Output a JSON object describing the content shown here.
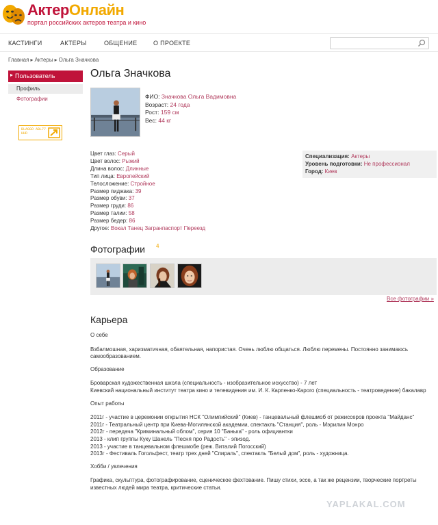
{
  "brand": {
    "title_part1": "Актер",
    "title_part2": "Онлайн",
    "subtitle": "портал российских актеров театра и кино"
  },
  "nav": {
    "items": [
      "КАСТИНГИ",
      "АКТЕРЫ",
      "ОБЩЕНИЕ",
      "О ПРОЕКТЕ"
    ]
  },
  "search": {
    "placeholder": "",
    "value": ""
  },
  "breadcrumb": [
    "Главная",
    "Актеры",
    "Ольга Значкова"
  ],
  "sidebar": {
    "header": "Пользователь",
    "items": [
      "Профиль",
      "Фотографии"
    ],
    "banner_text": "BLAGGO ABL77 HHD"
  },
  "profile": {
    "name": "Ольга Значкова",
    "fio_label": "ФИО:",
    "fio": "Значкова Ольга Вадимовна",
    "age_label": "Возраст:",
    "age": "24 года",
    "height_label": "Рост:",
    "height": "159 см",
    "weight_label": "Вес:",
    "weight": "44 кг"
  },
  "attributes": [
    {
      "label": "Цвет глаз:",
      "value": "Серый"
    },
    {
      "label": "Цвет волос:",
      "value": "Рыжий"
    },
    {
      "label": "Длина волос:",
      "value": "Длинные"
    },
    {
      "label": "Тип лица:",
      "value": "Европейский"
    },
    {
      "label": "Телосложение:",
      "value": "Стройное"
    },
    {
      "label": "Размер пиджака:",
      "value": "39"
    },
    {
      "label": "Размер обуви:",
      "value": "37"
    },
    {
      "label": "Размер груди:",
      "value": "86"
    },
    {
      "label": "Размер талии:",
      "value": "58"
    },
    {
      "label": "Размер бедер:",
      "value": "86"
    },
    {
      "label": "Другое:",
      "value": "Вокал Танец Загранпаспорт Переезд"
    }
  ],
  "info": [
    {
      "label": "Специализация:",
      "value": "Актеры"
    },
    {
      "label": "Уровень подготовки:",
      "value": "Не профессионал"
    },
    {
      "label": "Город:",
      "value": "Киев"
    }
  ],
  "photos": {
    "title": "Фотографии",
    "count": "4",
    "all_link": "Все фотографии »"
  },
  "career": {
    "title": "Карьера",
    "about_title": "О себе",
    "about_text": "Взбалмошная, харизматичная, обаятельная, напористая. Очень люблю общаться. Люблю перемены. Постоянно занимаюсь самообразованием.",
    "education_title": "Образование",
    "education_lines": [
      "Броварская художественная школа (специальность - изобразительное искусство) - 7 лет",
      "Киевский национальный институт театра кино и телевидения им. И. К. Карпенко-Карого (специальность - театроведение) бакалавр"
    ],
    "experience_title": "Опыт работы",
    "experience_lines": [
      "2011г - участие в церемонии открытия НСК \"Олимпийский\" (Киев) - танцевальный флешмоб от режиссеров проекта \"Майданс\"",
      "2011г - Театральный центр при Киева-Могилянской академии, спектакль \"Станция\", роль - Мэрилин Монро",
      "2012г - передача \"Криминальный облом\", серия 10 \"Банька\" - роль официантки",
      "2013 - клип группы Куку Шанель \"Песня про Радость\" - эпизод.",
      "2013 - участие в танцевальном флешмобе (реж. Виталий Погосский)",
      "2013г - Фестиваль Гогольфест, театр трех дней \"Спираль\", спектакль \"Белый дом\", роль - художница."
    ],
    "hobby_title": "Хобби / увлечения",
    "hobby_text": "Графика, скульптура, фотографирование, сценическое фехтование. Пишу стихи, эссе, а так же рецензии, творческие портреты известных людей мира театра, критические статьи."
  },
  "watermark": "YAPLAKAL.COM",
  "colors": {
    "brand_red": "#c0133a",
    "brand_yellow": "#f2a900",
    "link": "#b03a5c"
  }
}
